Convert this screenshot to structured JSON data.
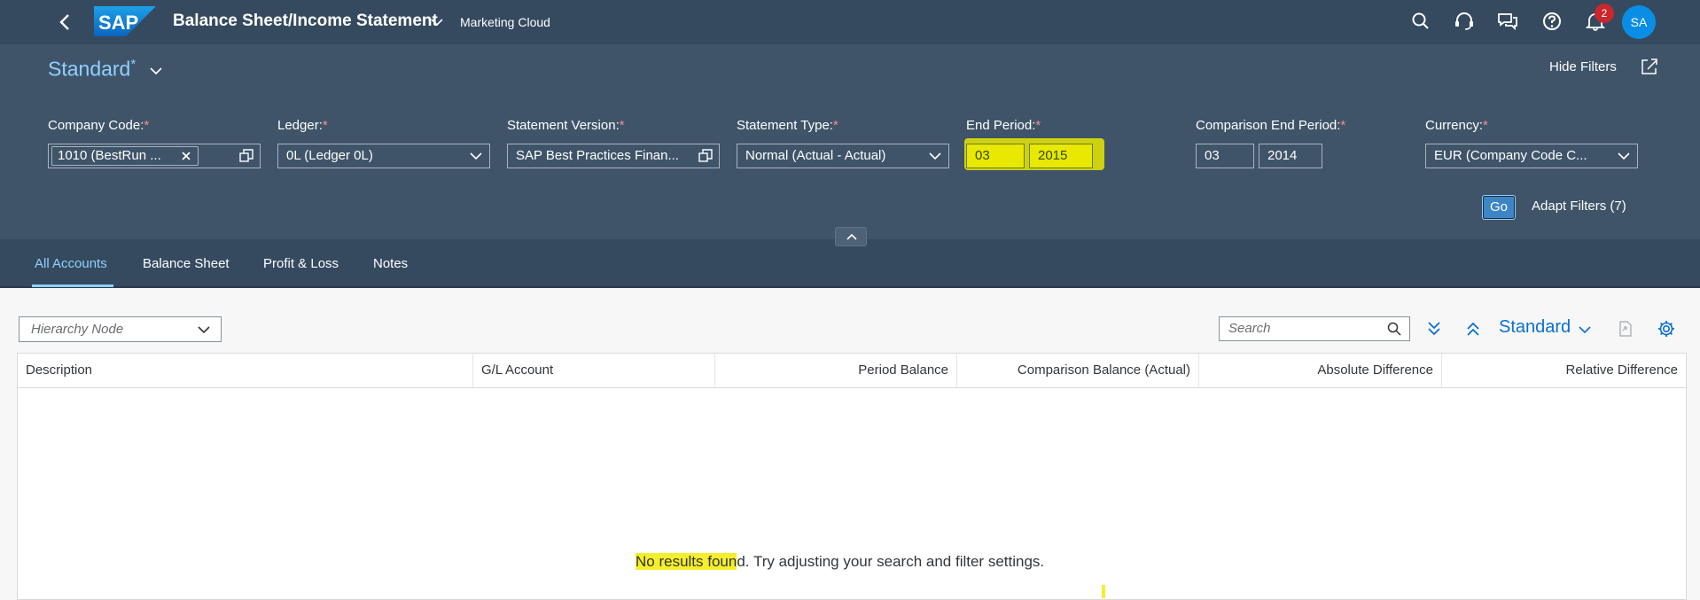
{
  "shell": {
    "logo_text": "SAP",
    "app_title": "Balance Sheet/Income Statement",
    "app_subtitle": "Marketing Cloud",
    "notification_count": "2",
    "avatar_initials": "SA",
    "icons": [
      "back-icon",
      "search-icon",
      "headset-icon",
      "chat-icon",
      "help-icon",
      "bell-icon"
    ]
  },
  "header": {
    "variant": "Standard",
    "variant_modified": "*",
    "hide_filters": "Hide Filters",
    "go_label": "Go",
    "adapt_filters": "Adapt Filters (7)"
  },
  "filters": {
    "company_code": {
      "label": "Company Code:",
      "token": "1010 (BestRun ..."
    },
    "ledger": {
      "label": "Ledger:",
      "value": "0L (Ledger 0L)"
    },
    "statement_version": {
      "label": "Statement Version:",
      "value": "SAP Best Practices Finan..."
    },
    "statement_type": {
      "label": "Statement Type:",
      "value": "Normal (Actual - Actual)"
    },
    "end_period": {
      "label": "End Period:",
      "period": "03",
      "year": "2015"
    },
    "comparison_end_period": {
      "label": "Comparison End Period:",
      "period": "03",
      "year": "2014"
    },
    "currency": {
      "label": "Currency:",
      "value": "EUR (Company Code C..."
    },
    "required_marker": "*"
  },
  "tabs": [
    {
      "label": "All Accounts",
      "active": true
    },
    {
      "label": "Balance Sheet",
      "active": false
    },
    {
      "label": "Profit & Loss",
      "active": false
    },
    {
      "label": "Notes",
      "active": false
    }
  ],
  "toolbar": {
    "hierarchy_placeholder": "Hierarchy Node",
    "search_placeholder": "Search",
    "variant": "Standard"
  },
  "table": {
    "columns": [
      "Description",
      "G/L Account",
      "Period Balance",
      "Comparison Balance (Actual)",
      "Absolute Difference",
      "Relative Difference"
    ],
    "rows": [],
    "no_data_highlight": "No results foun",
    "no_data_rest": "d. Try adjusting your search and filter settings."
  },
  "colors": {
    "shell": "#354a5f",
    "header": "#3f5469",
    "accent": "#8fd1ff",
    "link": "#0a6ed1",
    "highlight": "#e8e800"
  }
}
